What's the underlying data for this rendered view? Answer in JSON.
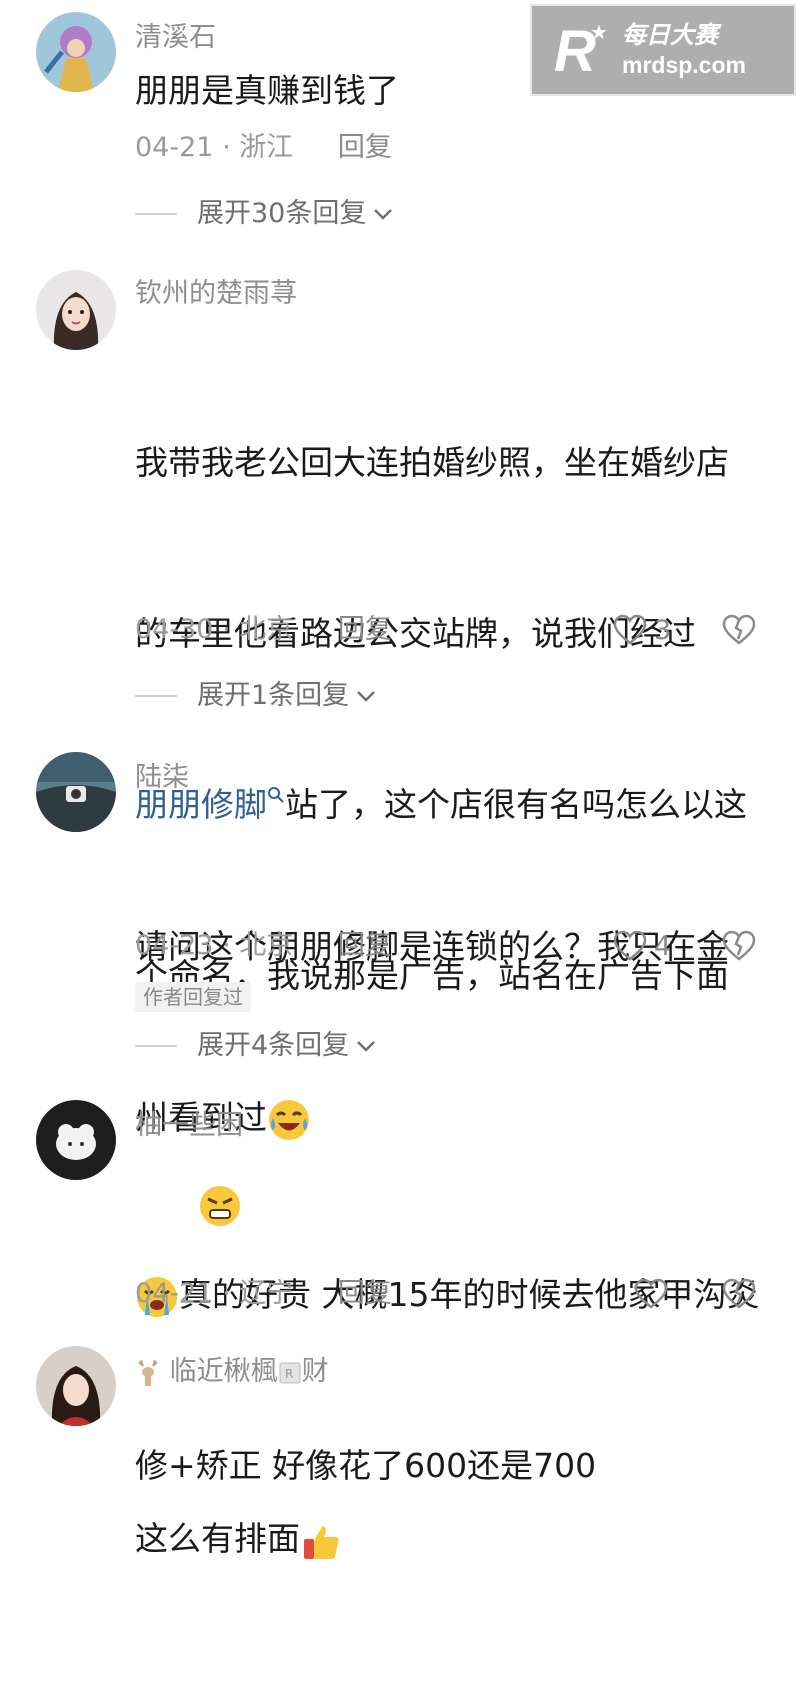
{
  "watermark": {
    "brand_cn": "每日大赛",
    "url": "mrdsp.com",
    "logo_letter": "R"
  },
  "comments": [
    {
      "username": "清溪石",
      "text": "朋朋是真赚到钱了",
      "date": "04-21",
      "location": "浙江",
      "reply_label": "回复",
      "expand_label": "展开30条回复"
    },
    {
      "username": "钦州的楚雨荨",
      "text_lines": [
        "我带我老公回大连拍婚纱照，坐在婚纱店",
        "的车里他看路边公交站牌，说我们经过"
      ],
      "link_text": "朋朋修脚",
      "text_after_link": "站了，这个店很有名吗怎么以这",
      "text_last": "个命名，我说那是广告，站名在广告下面",
      "date": "04-30",
      "location": "北京",
      "reply_label": "回复",
      "likes": "3",
      "expand_label": "展开1条回复"
    },
    {
      "username": "陆柒",
      "text_line1": "请问这个朋朋修脚是连锁的么？我只在金",
      "text_line2": "州看到过",
      "date": "04-23",
      "location": "北京",
      "reply_label": "回复",
      "likes": "4",
      "author_tag": "作者回复过",
      "expand_label": "展开4条回复"
    },
    {
      "username": "柚一些困",
      "text_line1": "真的好贵 大概15年的时候去他家甲沟炎",
      "text_line2": "修+矫正 好像花了600还是700",
      "date": "04-21",
      "location": "辽宁",
      "reply_label": "回复"
    },
    {
      "username": "临近楸楓",
      "username_tail": "财",
      "text": "这么有排面"
    }
  ],
  "colors": {
    "link": "#2f5f9a",
    "meta": "#9a9a9a",
    "username": "#8e8e8e"
  }
}
